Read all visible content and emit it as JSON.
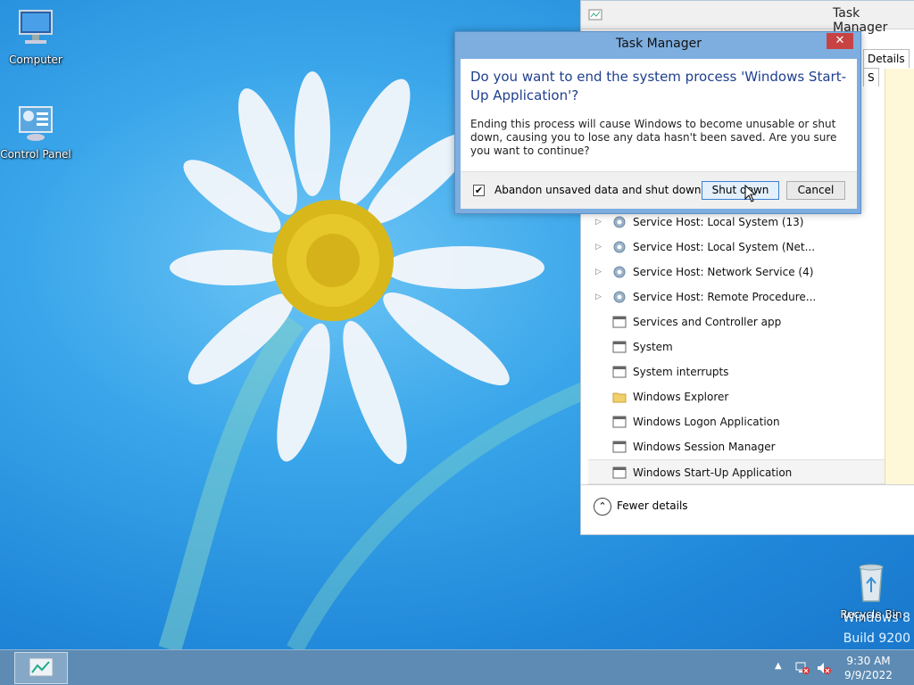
{
  "desktop": {
    "icons": [
      {
        "label": "Computer"
      },
      {
        "label": "Control Panel"
      },
      {
        "label": "Recycle Bin"
      }
    ],
    "watermark": {
      "line1": "Windows 8",
      "line2": "Build 9200"
    }
  },
  "task_manager": {
    "title": "Task Manager",
    "tabs": [
      "Details",
      "S"
    ],
    "processes": [
      {
        "name": "Service Host: Local System (13)",
        "expandable": true,
        "icon": "gear-icon"
      },
      {
        "name": "Service Host: Local System (Net...",
        "expandable": true,
        "icon": "gear-icon"
      },
      {
        "name": "Service Host: Network Service (4)",
        "expandable": true,
        "icon": "gear-icon"
      },
      {
        "name": "Service Host: Remote Procedure...",
        "expandable": true,
        "icon": "gear-icon"
      },
      {
        "name": "Services and Controller app",
        "expandable": false,
        "icon": "window-icon"
      },
      {
        "name": "System",
        "expandable": false,
        "icon": "window-icon"
      },
      {
        "name": "System interrupts",
        "expandable": false,
        "icon": "window-icon"
      },
      {
        "name": "Windows Explorer",
        "expandable": false,
        "icon": "folder-icon"
      },
      {
        "name": "Windows Logon Application",
        "expandable": false,
        "icon": "window-icon"
      },
      {
        "name": "Windows Session Manager",
        "expandable": false,
        "icon": "window-icon"
      },
      {
        "name": "Windows Start-Up Application",
        "expandable": false,
        "icon": "window-icon",
        "selected": true
      }
    ],
    "footer": {
      "fewer_details": "Fewer details"
    }
  },
  "dialog": {
    "title": "Task Manager",
    "close_label": "✕",
    "heading": "Do you want to end the system process 'Windows Start-Up Application'?",
    "body": "Ending this process will cause Windows to become unusable or shut down, causing you to lose any data hasn't been saved. Are you sure you want to continue?",
    "checkbox_label": "Abandon unsaved data and shut down.",
    "checkbox_checked": true,
    "shutdown_label": "Shut down",
    "cancel_label": "Cancel"
  },
  "taskbar": {
    "time": "9:30 AM",
    "date": "9/9/2022",
    "tray_chevron": "▲"
  },
  "colors": {
    "dialog_frame": "#7eaee0",
    "heading_blue": "#1f3f8f",
    "taskbar": "#5d8bb3",
    "close_red": "#c74343"
  }
}
